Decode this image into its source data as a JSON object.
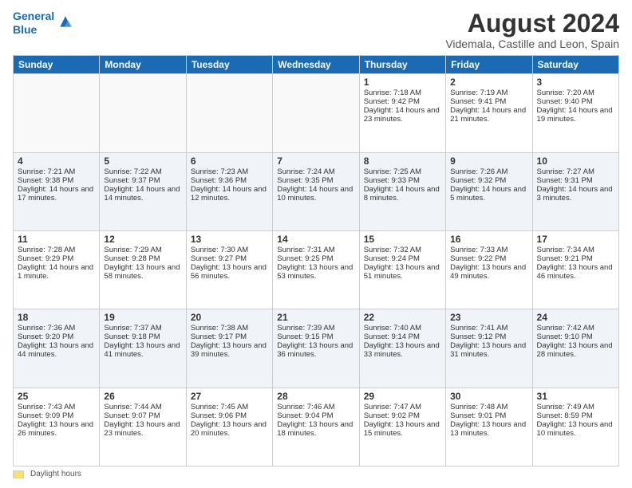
{
  "logo": {
    "line1": "General",
    "line2": "Blue"
  },
  "title": "August 2024",
  "subtitle": "Videmala, Castille and Leon, Spain",
  "days_of_week": [
    "Sunday",
    "Monday",
    "Tuesday",
    "Wednesday",
    "Thursday",
    "Friday",
    "Saturday"
  ],
  "weeks": [
    [
      {
        "day": "",
        "info": ""
      },
      {
        "day": "",
        "info": ""
      },
      {
        "day": "",
        "info": ""
      },
      {
        "day": "",
        "info": ""
      },
      {
        "day": "1",
        "info": "Sunrise: 7:18 AM\nSunset: 9:42 PM\nDaylight: 14 hours and 23 minutes."
      },
      {
        "day": "2",
        "info": "Sunrise: 7:19 AM\nSunset: 9:41 PM\nDaylight: 14 hours and 21 minutes."
      },
      {
        "day": "3",
        "info": "Sunrise: 7:20 AM\nSunset: 9:40 PM\nDaylight: 14 hours and 19 minutes."
      }
    ],
    [
      {
        "day": "4",
        "info": "Sunrise: 7:21 AM\nSunset: 9:38 PM\nDaylight: 14 hours and 17 minutes."
      },
      {
        "day": "5",
        "info": "Sunrise: 7:22 AM\nSunset: 9:37 PM\nDaylight: 14 hours and 14 minutes."
      },
      {
        "day": "6",
        "info": "Sunrise: 7:23 AM\nSunset: 9:36 PM\nDaylight: 14 hours and 12 minutes."
      },
      {
        "day": "7",
        "info": "Sunrise: 7:24 AM\nSunset: 9:35 PM\nDaylight: 14 hours and 10 minutes."
      },
      {
        "day": "8",
        "info": "Sunrise: 7:25 AM\nSunset: 9:33 PM\nDaylight: 14 hours and 8 minutes."
      },
      {
        "day": "9",
        "info": "Sunrise: 7:26 AM\nSunset: 9:32 PM\nDaylight: 14 hours and 5 minutes."
      },
      {
        "day": "10",
        "info": "Sunrise: 7:27 AM\nSunset: 9:31 PM\nDaylight: 14 hours and 3 minutes."
      }
    ],
    [
      {
        "day": "11",
        "info": "Sunrise: 7:28 AM\nSunset: 9:29 PM\nDaylight: 14 hours and 1 minute."
      },
      {
        "day": "12",
        "info": "Sunrise: 7:29 AM\nSunset: 9:28 PM\nDaylight: 13 hours and 58 minutes."
      },
      {
        "day": "13",
        "info": "Sunrise: 7:30 AM\nSunset: 9:27 PM\nDaylight: 13 hours and 56 minutes."
      },
      {
        "day": "14",
        "info": "Sunrise: 7:31 AM\nSunset: 9:25 PM\nDaylight: 13 hours and 53 minutes."
      },
      {
        "day": "15",
        "info": "Sunrise: 7:32 AM\nSunset: 9:24 PM\nDaylight: 13 hours and 51 minutes."
      },
      {
        "day": "16",
        "info": "Sunrise: 7:33 AM\nSunset: 9:22 PM\nDaylight: 13 hours and 49 minutes."
      },
      {
        "day": "17",
        "info": "Sunrise: 7:34 AM\nSunset: 9:21 PM\nDaylight: 13 hours and 46 minutes."
      }
    ],
    [
      {
        "day": "18",
        "info": "Sunrise: 7:36 AM\nSunset: 9:20 PM\nDaylight: 13 hours and 44 minutes."
      },
      {
        "day": "19",
        "info": "Sunrise: 7:37 AM\nSunset: 9:18 PM\nDaylight: 13 hours and 41 minutes."
      },
      {
        "day": "20",
        "info": "Sunrise: 7:38 AM\nSunset: 9:17 PM\nDaylight: 13 hours and 39 minutes."
      },
      {
        "day": "21",
        "info": "Sunrise: 7:39 AM\nSunset: 9:15 PM\nDaylight: 13 hours and 36 minutes."
      },
      {
        "day": "22",
        "info": "Sunrise: 7:40 AM\nSunset: 9:14 PM\nDaylight: 13 hours and 33 minutes."
      },
      {
        "day": "23",
        "info": "Sunrise: 7:41 AM\nSunset: 9:12 PM\nDaylight: 13 hours and 31 minutes."
      },
      {
        "day": "24",
        "info": "Sunrise: 7:42 AM\nSunset: 9:10 PM\nDaylight: 13 hours and 28 minutes."
      }
    ],
    [
      {
        "day": "25",
        "info": "Sunrise: 7:43 AM\nSunset: 9:09 PM\nDaylight: 13 hours and 26 minutes."
      },
      {
        "day": "26",
        "info": "Sunrise: 7:44 AM\nSunset: 9:07 PM\nDaylight: 13 hours and 23 minutes."
      },
      {
        "day": "27",
        "info": "Sunrise: 7:45 AM\nSunset: 9:06 PM\nDaylight: 13 hours and 20 minutes."
      },
      {
        "day": "28",
        "info": "Sunrise: 7:46 AM\nSunset: 9:04 PM\nDaylight: 13 hours and 18 minutes."
      },
      {
        "day": "29",
        "info": "Sunrise: 7:47 AM\nSunset: 9:02 PM\nDaylight: 13 hours and 15 minutes."
      },
      {
        "day": "30",
        "info": "Sunrise: 7:48 AM\nSunset: 9:01 PM\nDaylight: 13 hours and 13 minutes."
      },
      {
        "day": "31",
        "info": "Sunrise: 7:49 AM\nSunset: 8:59 PM\nDaylight: 13 hours and 10 minutes."
      }
    ]
  ],
  "footer": {
    "box_label": "Daylight hours"
  }
}
